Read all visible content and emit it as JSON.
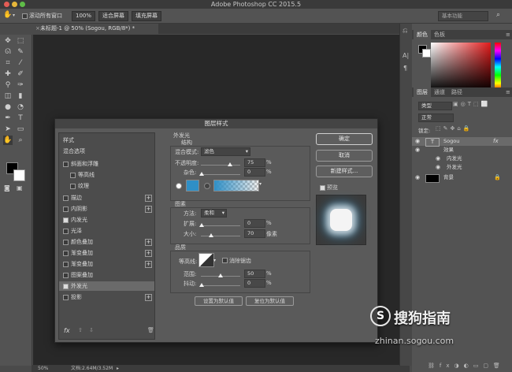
{
  "app": {
    "title": "Adobe Photoshop CC 2015.5"
  },
  "options_bar": {
    "scroll_all_label": "滚动所有窗口",
    "zoom_value": "100%",
    "fit_screen_label": "适合屏幕",
    "fill_screen_label": "填充屏幕",
    "workspace": "基本功能"
  },
  "document": {
    "tab_title": "未标题-1 @ 50% (Sogou, RGB/8*) *",
    "zoom": "50%",
    "doc_info": "文档:2.64M/3.52M"
  },
  "dialog": {
    "title": "图层样式",
    "styles_header": "样式",
    "blend_options": "混合选项",
    "style_items": [
      {
        "label": "斜面和浮雕",
        "checked": false,
        "plus": false
      },
      {
        "label": "等高线",
        "checked": false,
        "plus": false
      },
      {
        "label": "纹理",
        "checked": false,
        "plus": false
      },
      {
        "label": "描边",
        "checked": false,
        "plus": true
      },
      {
        "label": "内阴影",
        "checked": false,
        "plus": true
      },
      {
        "label": "内发光",
        "checked": true,
        "plus": false
      },
      {
        "label": "光泽",
        "checked": false,
        "plus": false
      },
      {
        "label": "颜色叠加",
        "checked": false,
        "plus": true
      },
      {
        "label": "渐变叠加",
        "checked": false,
        "plus": true
      },
      {
        "label": "渐变叠加",
        "checked": false,
        "plus": true
      },
      {
        "label": "图案叠加",
        "checked": false,
        "plus": false
      },
      {
        "label": "外发光",
        "checked": true,
        "plus": false
      },
      {
        "label": "投影",
        "checked": false,
        "plus": true
      }
    ],
    "fx_label": "fx",
    "outer_glow": {
      "section": "外发光",
      "structure": "结构",
      "blend_mode_label": "混合模式:",
      "blend_mode": "滤色",
      "opacity_label": "不透明度:",
      "opacity": "75",
      "noise_label": "杂色:",
      "noise": "0",
      "elements": "图素",
      "technique_label": "方法:",
      "technique": "柔和",
      "spread_label": "扩展:",
      "spread": "0",
      "size_label": "大小:",
      "size": "70",
      "size_unit": "像素",
      "quality": "品质",
      "contour_label": "等高线:",
      "antialias_label": "消除锯齿",
      "range_label": "范围:",
      "range": "50",
      "jitter_label": "抖动:",
      "jitter": "0",
      "percent": "%",
      "set_default": "设置为默认值",
      "reset_default": "复位为默认值"
    },
    "buttons": {
      "ok": "确定",
      "cancel": "取消",
      "new_style": "新建样式...",
      "preview": "预览"
    }
  },
  "right_panel": {
    "color_tabs": [
      "颜色",
      "色板"
    ],
    "layer_tabs": [
      "图层",
      "通道",
      "路径"
    ],
    "kind_filter": "类型",
    "blend": "正常",
    "lock_label": "锁定:",
    "layers": [
      {
        "name": "Sogou",
        "type": "text"
      },
      {
        "name": "效果",
        "type": "effects"
      },
      {
        "name": "内发光",
        "type": "effect"
      },
      {
        "name": "外发光",
        "type": "effect"
      },
      {
        "name": "背景",
        "type": "bg"
      }
    ]
  },
  "watermark": {
    "brand": "搜狗指南",
    "url": "zhinan.sogou.com"
  },
  "colors": {
    "glow_color": "#2f8fc6",
    "accent": "#3b8fd3"
  }
}
